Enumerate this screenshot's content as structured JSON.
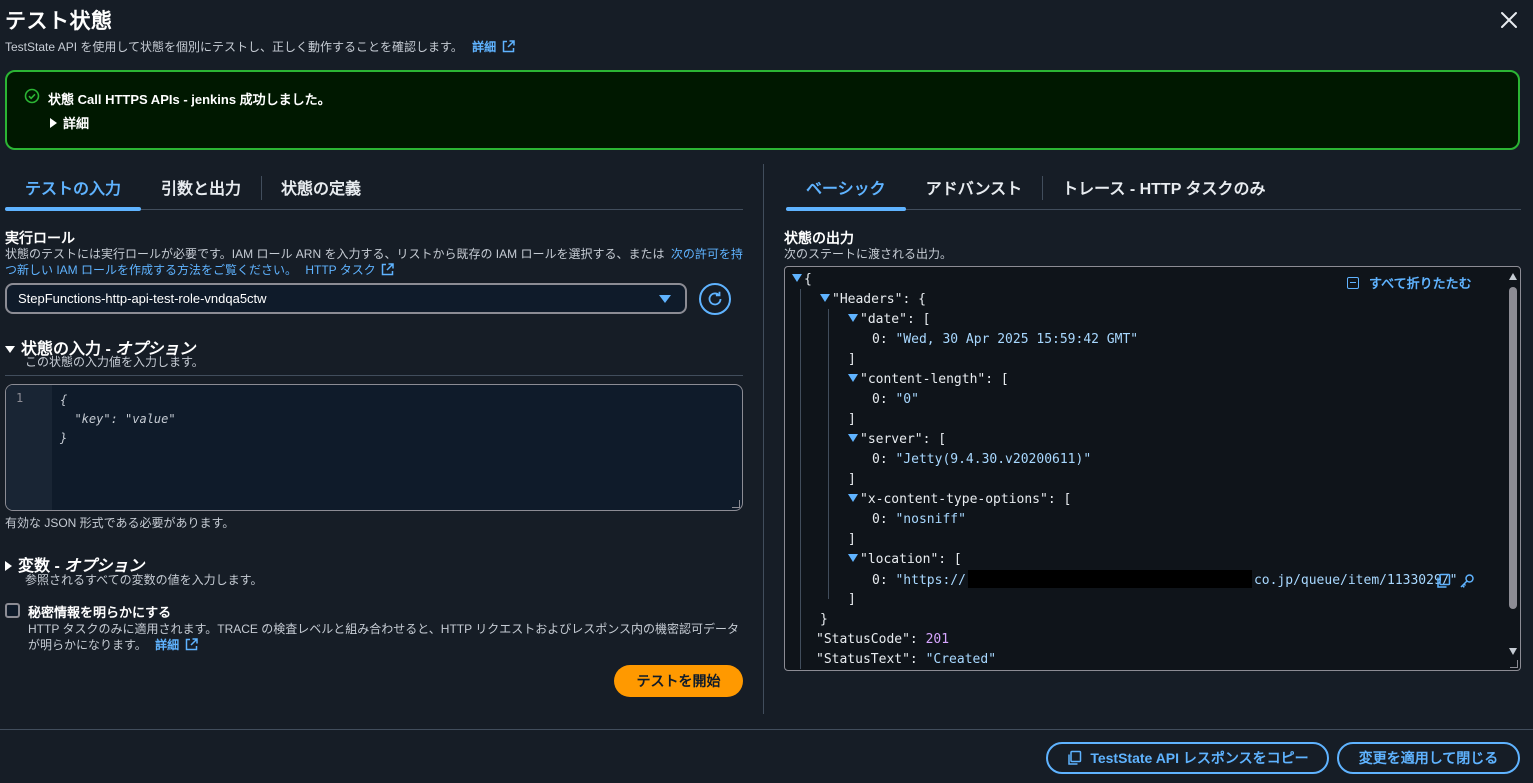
{
  "header": {
    "title": "テスト状態",
    "subtitle": "TestState API を使用して状態を個別にテストし、正しく動作することを確認します。",
    "details_link": "詳細"
  },
  "banner": {
    "message": "状態 Call HTTPS APIs - jenkins 成功しました。",
    "details_label": "詳細",
    "status_color": "#2bb534"
  },
  "left_tabs": [
    {
      "label": "テストの入力",
      "active": true
    },
    {
      "label": "引数と出力",
      "active": false
    },
    {
      "label": "状態の定義",
      "active": false
    }
  ],
  "role": {
    "label": "実行ロール",
    "desc_line1": "状態のテストには実行ロールが必要です。IAM ロール ARN を入力する、リストから既存の IAM ロールを選択する、または",
    "desc_link_a": "次の許可を持",
    "desc_link_b": "つ新しい IAM ロールを作成する方法をご覧ください。",
    "http_task_link": "HTTP タスク",
    "selected": "StepFunctions-http-api-test-role-vndqa5ctw"
  },
  "state_input": {
    "title": "状態の入力",
    "title_suffix": "オプション",
    "desc": "この状態の入力値を入力します。",
    "line_number": "1",
    "code_line1": "{",
    "code_line2": "  \"key\": \"value\"",
    "code_line3": "}",
    "hint": "有効な JSON 形式である必要があります。"
  },
  "variables": {
    "title": "変数",
    "title_suffix": "オプション",
    "desc": "参照されるすべての変数の値を入力します。"
  },
  "reveal_secrets": {
    "label": "秘密情報を明らかにする",
    "desc_line1": "HTTP タスクのみに適用されます。TRACE の検査レベルと組み合わせると、HTTP リクエストおよびレスポンス内の機密認可データ",
    "desc_line2": "が明らかになります。",
    "details_link": "詳細",
    "checked": false
  },
  "start_button": "テストを開始",
  "right_tabs": [
    {
      "label": "ベーシック",
      "active": true
    },
    {
      "label": "アドバンスト",
      "active": false
    },
    {
      "label": "トレース - HTTP タスクのみ",
      "active": false
    }
  ],
  "output": {
    "label": "状態の出力",
    "desc": "次のステートに渡される出力。",
    "collapse_all": "すべて折りたたむ",
    "json": {
      "open_brace": "{",
      "headers_key": "\"Headers\"",
      "date_key": "\"date\"",
      "date_val": "\"Wed, 30 Apr 2025 15:59:42 GMT\"",
      "content_length_key": "\"content-length\"",
      "content_length_val": "\"0\"",
      "server_key": "\"server\"",
      "server_val": "\"Jetty(9.4.30.v20200611)\"",
      "xcto_key": "\"x-content-type-options\"",
      "xcto_val": "\"nosniff\"",
      "location_key": "\"location\"",
      "location_val_prefix": "\"https://",
      "location_val_suffix": "co.jp/queue/item/1133029/\"",
      "status_code_key": "\"StatusCode\"",
      "status_code_val": "201",
      "status_text_key": "\"StatusText\"",
      "status_text_val": "\"Created\"",
      "index0": "0:",
      "colon_bracket": ": [",
      "colon_brace": ": {",
      "close_bracket": "]",
      "close_brace": "}",
      "colon": ": "
    }
  },
  "footer": {
    "copy_button": "TestState API レスポンスをコピー",
    "apply_button": "変更を適用して閉じる"
  }
}
